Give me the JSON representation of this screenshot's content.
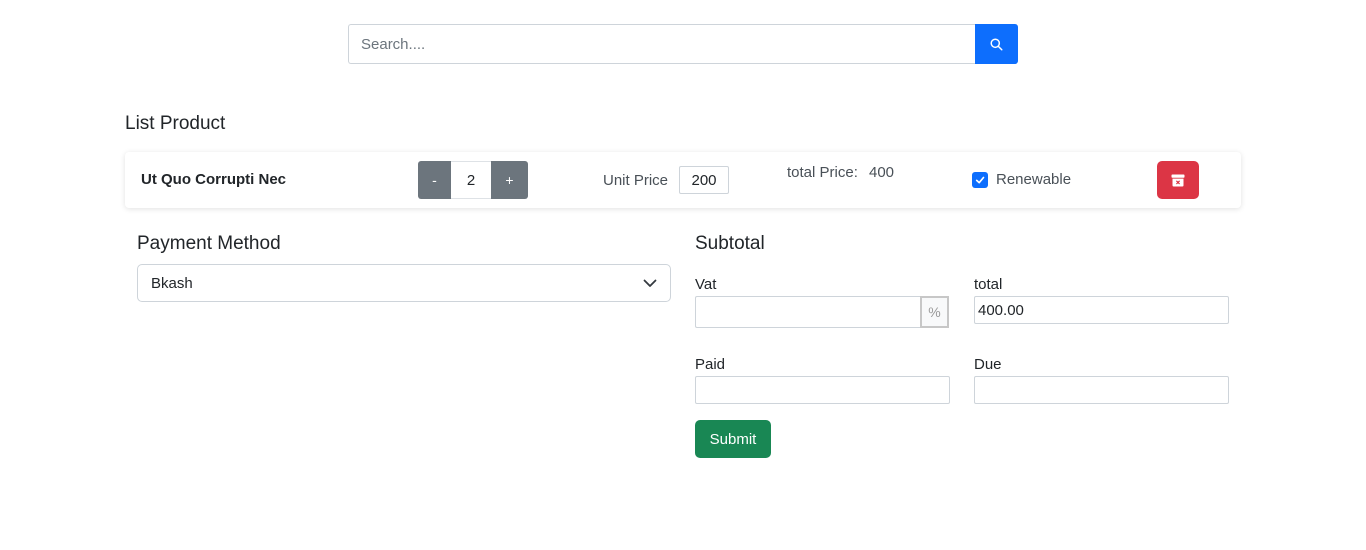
{
  "search": {
    "placeholder": "Search....",
    "value": "",
    "button_icon": "search-icon"
  },
  "list": {
    "title": "List Product",
    "products": [
      {
        "name": "Ut Quo Corrupti Nec",
        "qty_minus": "-",
        "quantity": "2",
        "qty_plus": "+",
        "unit_price_label": "Unit Price",
        "unit_price": "200",
        "total_price_label": "total Price:",
        "total_price": "400",
        "renewable_label": "Renewable",
        "renewable_checked": true,
        "delete_icon": "trash-icon"
      }
    ]
  },
  "payment": {
    "title": "Payment Method",
    "selected": "Bkash"
  },
  "subtotal": {
    "title": "Subtotal",
    "vat_label": "Vat",
    "vat_value": "",
    "vat_suffix": "%",
    "total_label": "total",
    "total_value": "400.00",
    "paid_label": "Paid",
    "paid_value": "",
    "due_label": "Due",
    "due_value": "",
    "submit_label": "Submit"
  },
  "colors": {
    "primary": "#0d6efd",
    "secondary": "#6c757d",
    "danger": "#dc3545",
    "success": "#198754"
  }
}
